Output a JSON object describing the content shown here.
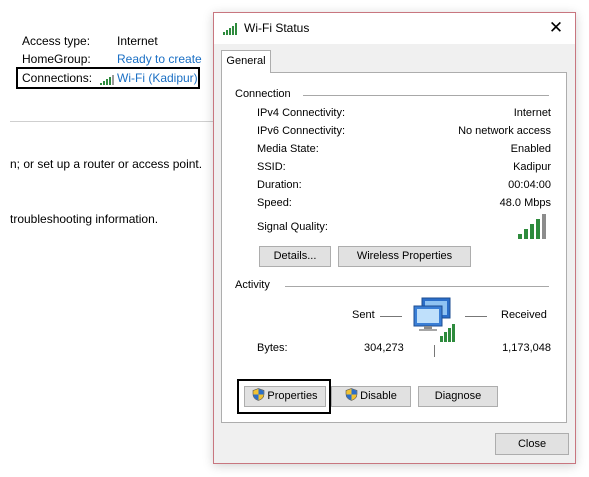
{
  "background": {
    "rows": [
      {
        "label": "Access type:",
        "value": "Internet",
        "is_link": false
      },
      {
        "label": "HomeGroup:",
        "value": "Ready to create",
        "is_link": true
      },
      {
        "label": "Connections:",
        "value": "Wi-Fi (Kadipur)",
        "is_link": true
      }
    ],
    "text1": "n; or set up a router or access point.",
    "text2": "troubleshooting information."
  },
  "dialog": {
    "title": "Wi-Fi Status",
    "close_glyph": "✕",
    "tab": "General",
    "connection_label": "Connection",
    "connection_items": [
      {
        "label": "IPv4 Connectivity:",
        "value": "Internet"
      },
      {
        "label": "IPv6 Connectivity:",
        "value": "No network access"
      },
      {
        "label": "Media State:",
        "value": "Enabled"
      },
      {
        "label": "SSID:",
        "value": "Kadipur"
      },
      {
        "label": "Duration:",
        "value": "00:04:00"
      },
      {
        "label": "Speed:",
        "value": "48.0 Mbps"
      }
    ],
    "signal_quality_label": "Signal Quality:",
    "signal_bars_filled": 4,
    "signal_bars_total": 5,
    "buttons": {
      "details": "Details...",
      "wireless_properties": "Wireless Properties",
      "properties": "Properties",
      "disable": "Disable",
      "diagnose": "Diagnose",
      "close": "Close"
    },
    "activity_label": "Activity",
    "sent_label": "Sent",
    "received_label": "Received",
    "bytes_label": "Bytes:",
    "bytes_sent": "304,273",
    "bytes_received": "1,173,048"
  },
  "colors": {
    "link": "#1a6fc4",
    "signal": "#2e8b3d",
    "dialog_border": "#c8767f"
  },
  "icons": [
    "wifi-signal-icon",
    "network-computer-icon",
    "uac-shield-icon"
  ]
}
